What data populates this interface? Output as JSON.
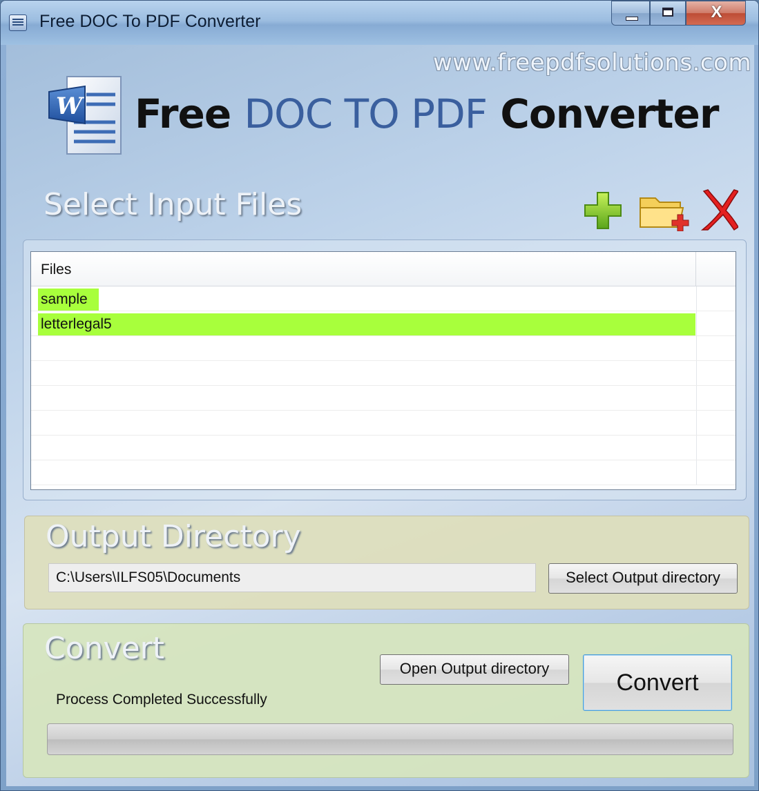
{
  "window": {
    "title": "Free DOC To PDF Converter",
    "close_symbol": "X"
  },
  "header": {
    "website": "www.freepdfsolutions.com",
    "headline_part1": "Free ",
    "headline_part2": "DOC TO PDF",
    "headline_part3": " Converter",
    "logo_icon": "word-document-logo",
    "logo_letter": "W"
  },
  "input": {
    "title": "Select Input Files",
    "add_file_icon": "plus-icon",
    "add_folder_icon": "folder-add-icon",
    "remove_icon": "delete-x-icon",
    "column_header": "Files",
    "files": [
      "sample",
      "letterlegal5"
    ]
  },
  "output": {
    "title": "Output Directory",
    "path": "C:\\Users\\ILFS05\\Documents",
    "select_button": "Select Output directory"
  },
  "convert": {
    "title": "Convert",
    "open_button": "Open Output directory",
    "convert_button": "Convert",
    "status": "Process Completed Successfully",
    "progress": 0
  },
  "colors": {
    "highlight": "#a8ff3c",
    "headline_blue": "#3a5f9e"
  }
}
